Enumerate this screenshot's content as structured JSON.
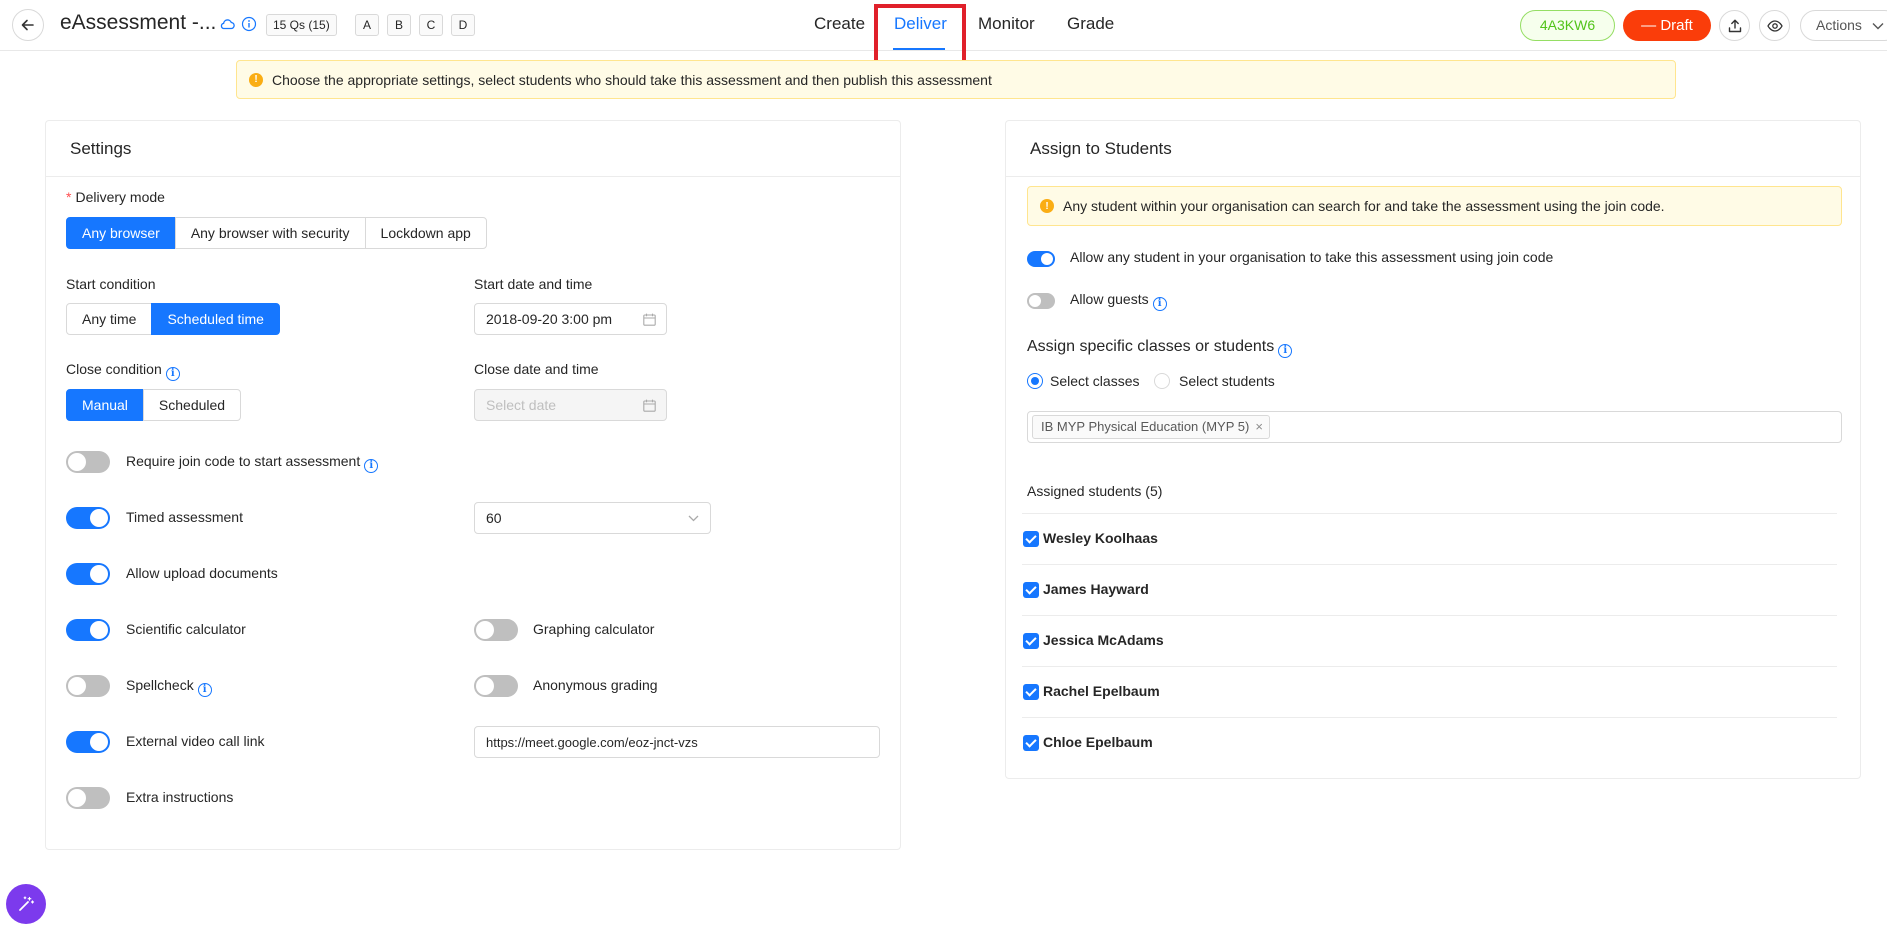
{
  "header": {
    "title": "eAssessment -...",
    "questions_badge": "15 Qs (15)",
    "versions": [
      "A",
      "B",
      "C",
      "D"
    ],
    "tabs": [
      "Create",
      "Deliver",
      "Monitor",
      "Grade"
    ],
    "active_tab": "Deliver",
    "join_code": "4A3KW6",
    "status": "Draft",
    "actions_label": "Actions",
    "colors": {
      "accent": "#1677ff",
      "draft": "#fa3d0a",
      "code": "#52c41a",
      "highlight": "#e0202a"
    }
  },
  "banner": {
    "text": "Choose the appropriate settings, select students who should take this assessment and then publish this assessment"
  },
  "settings": {
    "title": "Settings",
    "delivery_mode": {
      "label": "Delivery mode",
      "options": [
        "Any browser",
        "Any browser with security",
        "Lockdown app"
      ],
      "selected": "Any browser"
    },
    "start_condition": {
      "label": "Start condition",
      "options": [
        "Any time",
        "Scheduled time"
      ],
      "selected": "Scheduled time"
    },
    "start_datetime": {
      "label": "Start date and time",
      "value": "2018-09-20 3:00 pm"
    },
    "close_condition": {
      "label": "Close condition",
      "options": [
        "Manual",
        "Scheduled"
      ],
      "selected": "Manual"
    },
    "close_datetime": {
      "label": "Close date and time",
      "placeholder": "Select date"
    },
    "toggles": {
      "join_code": {
        "label": "Require join code to start assessment",
        "on": false
      },
      "timed": {
        "label": "Timed assessment",
        "on": true,
        "value": "60"
      },
      "upload": {
        "label": "Allow upload documents",
        "on": true
      },
      "scientific_calc": {
        "label": "Scientific calculator",
        "on": true
      },
      "graphing_calc": {
        "label": "Graphing calculator",
        "on": false
      },
      "spellcheck": {
        "label": "Spellcheck",
        "on": false
      },
      "anonymous": {
        "label": "Anonymous grading",
        "on": false
      },
      "video_call": {
        "label": "External video call link",
        "on": true,
        "value": "https://meet.google.com/eoz-jnct-vzs"
      },
      "extra": {
        "label": "Extra instructions",
        "on": false
      }
    }
  },
  "assign": {
    "title": "Assign to Students",
    "notice": "Any student within your organisation can search for and take the assessment using the join code.",
    "allow_any": {
      "label": "Allow any student in your organisation to take this assessment using join code",
      "on": true
    },
    "allow_guests": {
      "label": "Allow guests",
      "on": false
    },
    "specific_title": "Assign specific classes or students",
    "radio_classes": "Select classes",
    "radio_students": "Select students",
    "selected_radio": "Select classes",
    "class_tag": "IB MYP Physical Education (MYP 5)",
    "assigned_label": "Assigned students (5)",
    "students": [
      "Wesley Koolhaas",
      "James Hayward",
      "Jessica McAdams",
      "Rachel Epelbaum",
      "Chloe Epelbaum"
    ]
  }
}
